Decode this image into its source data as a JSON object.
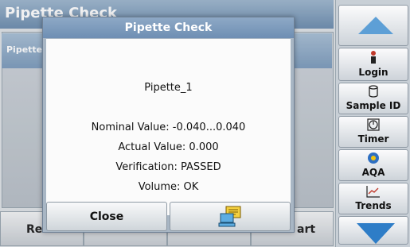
{
  "background": {
    "title": "Pipette Check",
    "row_label": "Pipette",
    "bottom_left_label": "Re",
    "bottom_right_label": "art"
  },
  "sidebar": {
    "up_icon": "triangle-up-arrow",
    "down_icon": "triangle-down-arrow",
    "items": [
      {
        "label": "Login",
        "icon": "person-icon"
      },
      {
        "label": "Sample ID",
        "icon": "cylinder-icon"
      },
      {
        "label": "Timer",
        "icon": "stopwatch-icon"
      },
      {
        "label": "AQA",
        "icon": "aqa-icon"
      },
      {
        "label": "Trends",
        "icon": "chart-icon"
      }
    ]
  },
  "dialog": {
    "title": "Pipette Check",
    "pipette_name": "Pipette_1",
    "nominal_value": "Nominal Value: -0.040...0.040",
    "actual_value": "Actual Value: 0.000",
    "verification": "Verification: PASSED",
    "volume": "Volume: OK",
    "close_label": "Close",
    "transfer_icon": "computer-transfer-icon"
  },
  "colors": {
    "title_blue": "#6e8eb3",
    "arrow_blue": "#2e7dc7"
  }
}
